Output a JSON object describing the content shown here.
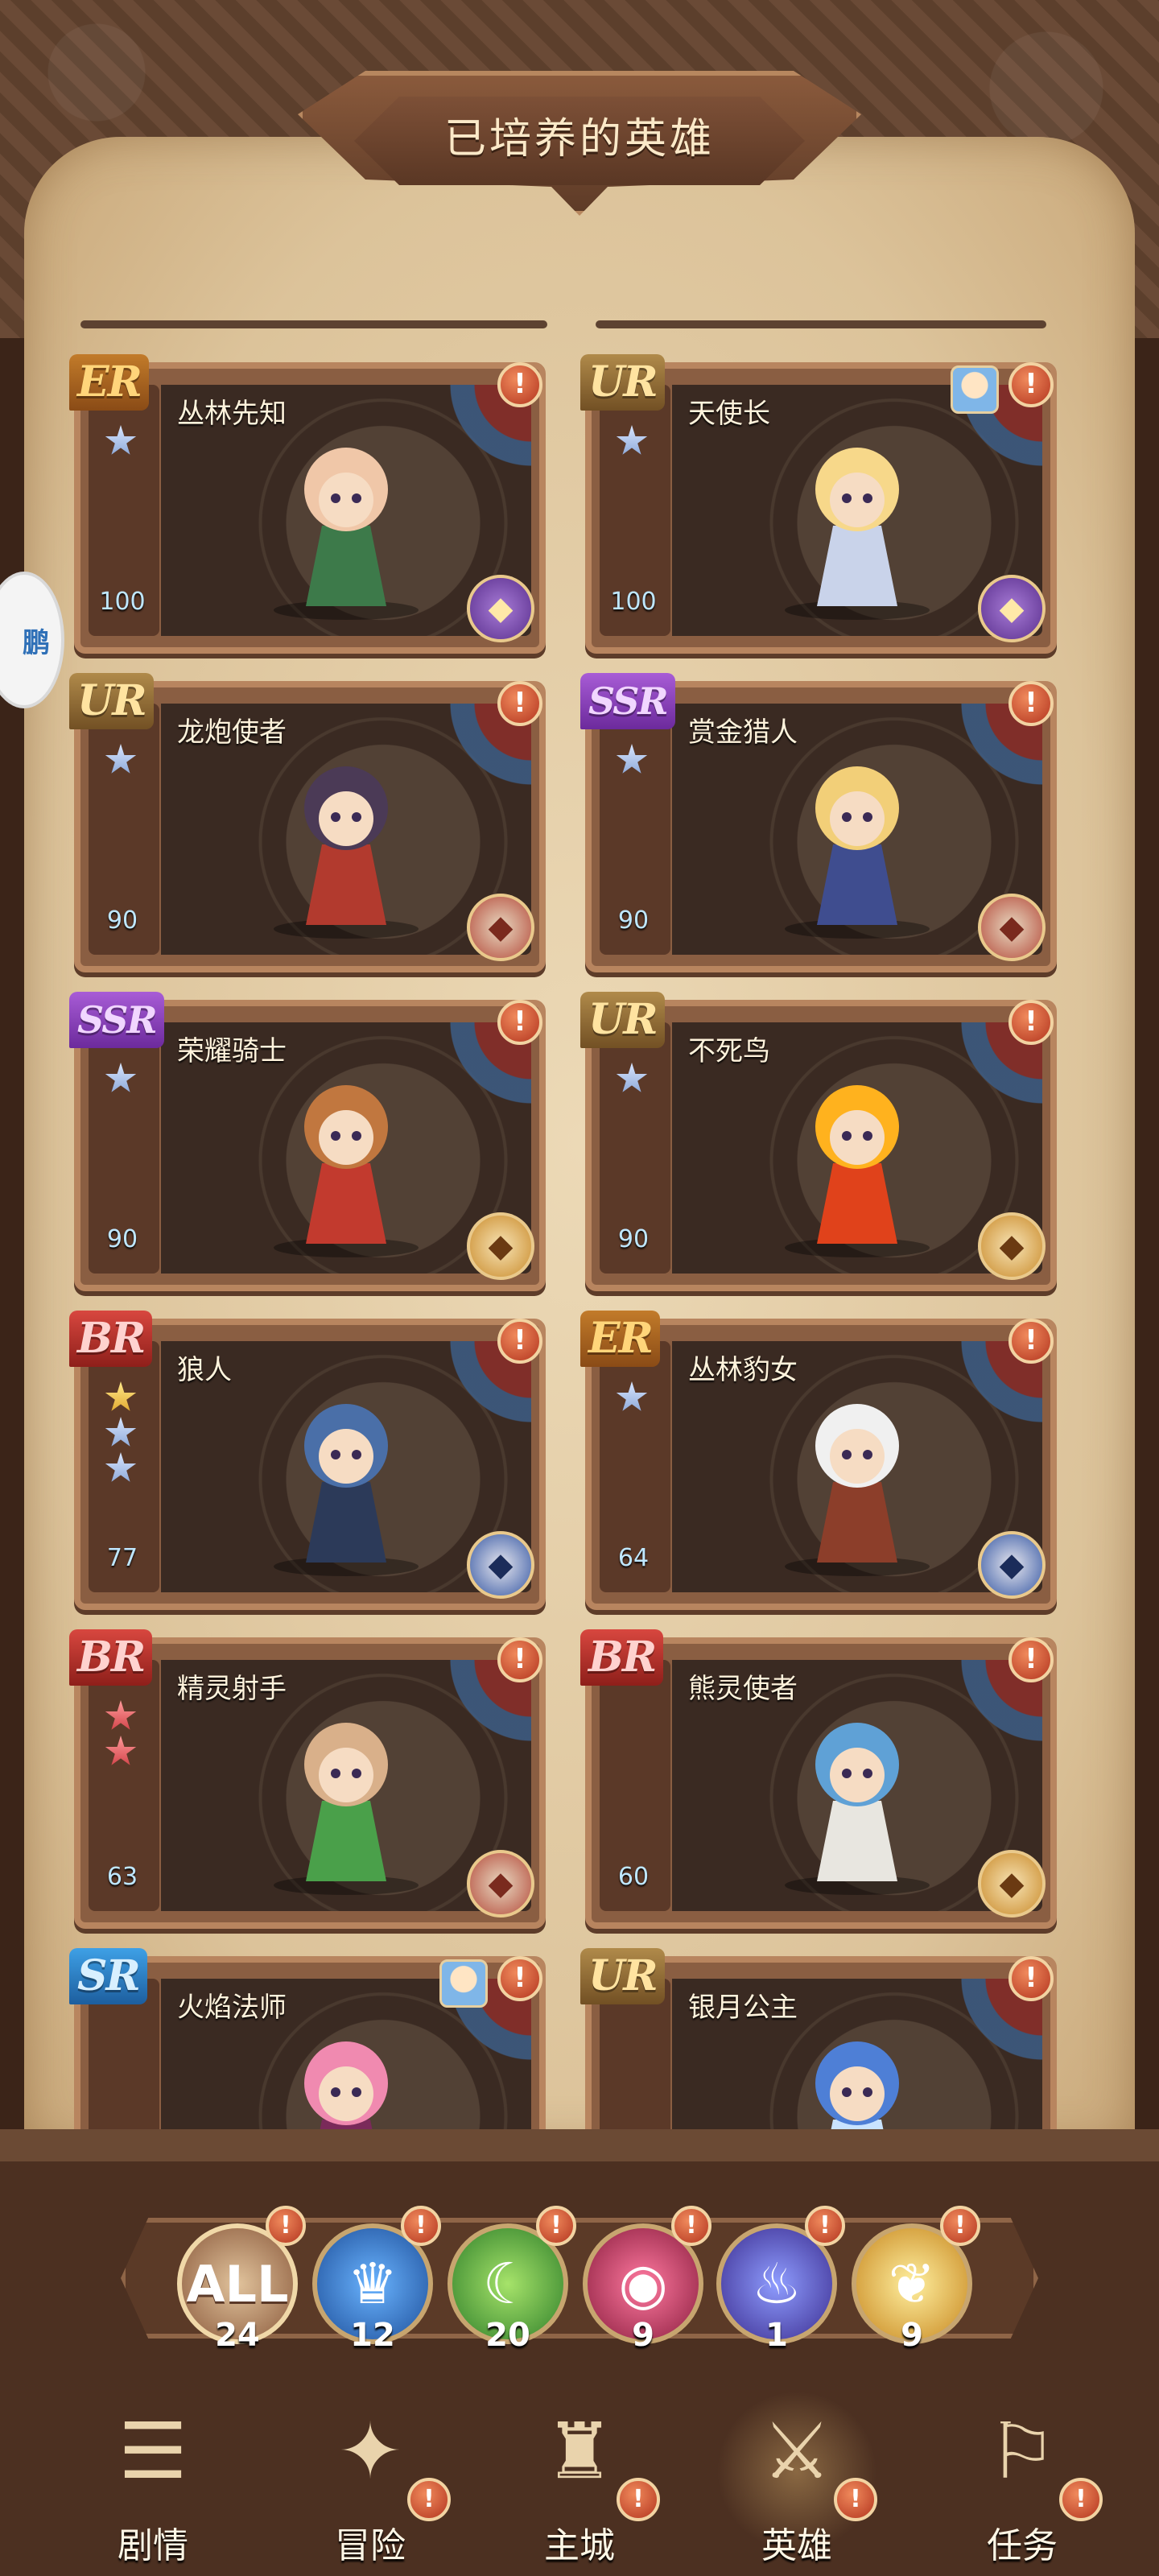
{
  "page_title": "已培养的英雄",
  "side_badge_text": "鹏",
  "cards": [
    {
      "rarity": "ER",
      "name": "丛林先知",
      "level": "100",
      "stars": [
        "blue"
      ],
      "class": "purple",
      "alert": "!"
    },
    {
      "rarity": "UR",
      "name": "天使长",
      "level": "100",
      "stars": [
        "blue"
      ],
      "class": "purple",
      "alert": "!"
    },
    {
      "rarity": "UR",
      "name": "龙炮使者",
      "level": "90",
      "stars": [
        "blue"
      ],
      "class": "red",
      "alert": "!"
    },
    {
      "rarity": "SSR",
      "name": "赏金猎人",
      "level": "90",
      "stars": [
        "blue"
      ],
      "class": "red",
      "alert": "!"
    },
    {
      "rarity": "SSR",
      "name": "荣耀骑士",
      "level": "90",
      "stars": [
        "blue"
      ],
      "class": "gold",
      "alert": "!"
    },
    {
      "rarity": "UR",
      "name": "不死鸟",
      "level": "90",
      "stars": [
        "blue"
      ],
      "class": "gold",
      "alert": "!"
    },
    {
      "rarity": "BR",
      "name": "狼人",
      "level": "77",
      "stars": [
        "gold",
        "blue",
        "blue"
      ],
      "class": "blue",
      "alert": "!"
    },
    {
      "rarity": "ER",
      "name": "丛林豹女",
      "level": "64",
      "stars": [
        "blue"
      ],
      "class": "blue",
      "alert": "!"
    },
    {
      "rarity": "BR",
      "name": "精灵射手",
      "level": "63",
      "stars": [
        "red",
        "red"
      ],
      "class": "red",
      "alert": "!"
    },
    {
      "rarity": "BR",
      "name": "熊灵使者",
      "level": "60",
      "stars": [],
      "class": "gold",
      "alert": "!"
    },
    {
      "rarity": "SR",
      "name": "火焰法师",
      "level": "",
      "stars": [],
      "class": "red",
      "alert": "!"
    },
    {
      "rarity": "UR",
      "name": "银月公主",
      "level": "",
      "stars": [],
      "class": "blue",
      "alert": "!"
    }
  ],
  "filters": [
    {
      "label": "ALL",
      "count": "24",
      "icon": "all-icon"
    },
    {
      "label": "",
      "count": "12",
      "icon": "crown-icon"
    },
    {
      "label": "",
      "count": "20",
      "icon": "moon-icon"
    },
    {
      "label": "",
      "count": "9",
      "icon": "eye-icon"
    },
    {
      "label": "",
      "count": "1",
      "icon": "spirit-icon"
    },
    {
      "label": "",
      "count": "9",
      "icon": "wings-icon"
    }
  ],
  "filter_alert": "!",
  "nav": [
    {
      "label": "剧情",
      "icon": "scroll-book-icon",
      "alert": ""
    },
    {
      "label": "冒险",
      "icon": "shield-emblem-icon",
      "alert": "!"
    },
    {
      "label": "主城",
      "icon": "castle-icon",
      "alert": "!"
    },
    {
      "label": "英雄",
      "icon": "helmet-icon",
      "alert": "!"
    },
    {
      "label": "任务",
      "icon": "map-icon",
      "alert": "!"
    }
  ]
}
